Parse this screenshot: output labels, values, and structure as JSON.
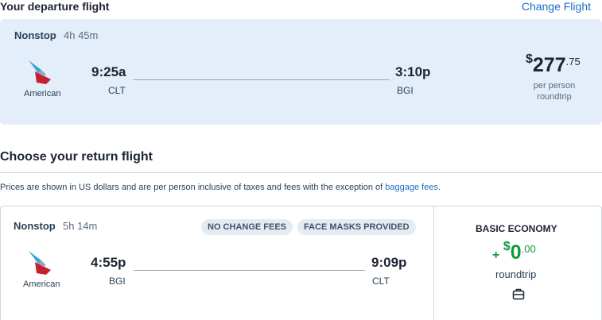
{
  "departure": {
    "heading": "Your departure flight",
    "change_label": "Change Flight",
    "stops": "Nonstop",
    "duration": "4h 45m",
    "airline": "American",
    "depart_time": "9:25a",
    "depart_code": "CLT",
    "arrive_time": "3:10p",
    "arrive_code": "BGI",
    "price_currency": "$",
    "price_whole": "277",
    "price_cents": ".75",
    "price_sub1": "per person",
    "price_sub2": "roundtrip"
  },
  "return_section": {
    "heading": "Choose your return flight",
    "note_text": "Prices are shown in US dollars and are per person inclusive of taxes and fees with the exception of ",
    "note_link": "baggage fees",
    "note_end": "."
  },
  "return_flight": {
    "stops": "Nonstop",
    "duration": "5h 14m",
    "badges": [
      "NO CHANGE FEES",
      "FACE MASKS PROVIDED"
    ],
    "airline": "American",
    "depart_time": "4:55p",
    "depart_code": "BGI",
    "arrive_time": "9:09p",
    "arrive_code": "CLT",
    "fare_name": "BASIC ECONOMY",
    "fare_plus": "+",
    "fare_currency": "$",
    "fare_whole": "0",
    "fare_cents": ".00",
    "fare_sub": "roundtrip",
    "bag_icon": "carry-on-bag-icon"
  },
  "colors": {
    "link": "#1b6fc7",
    "card_bg": "#e3eefa",
    "price_green": "#0f9a3c",
    "logo_red": "#c5202f",
    "logo_blue": "#36a3da"
  }
}
